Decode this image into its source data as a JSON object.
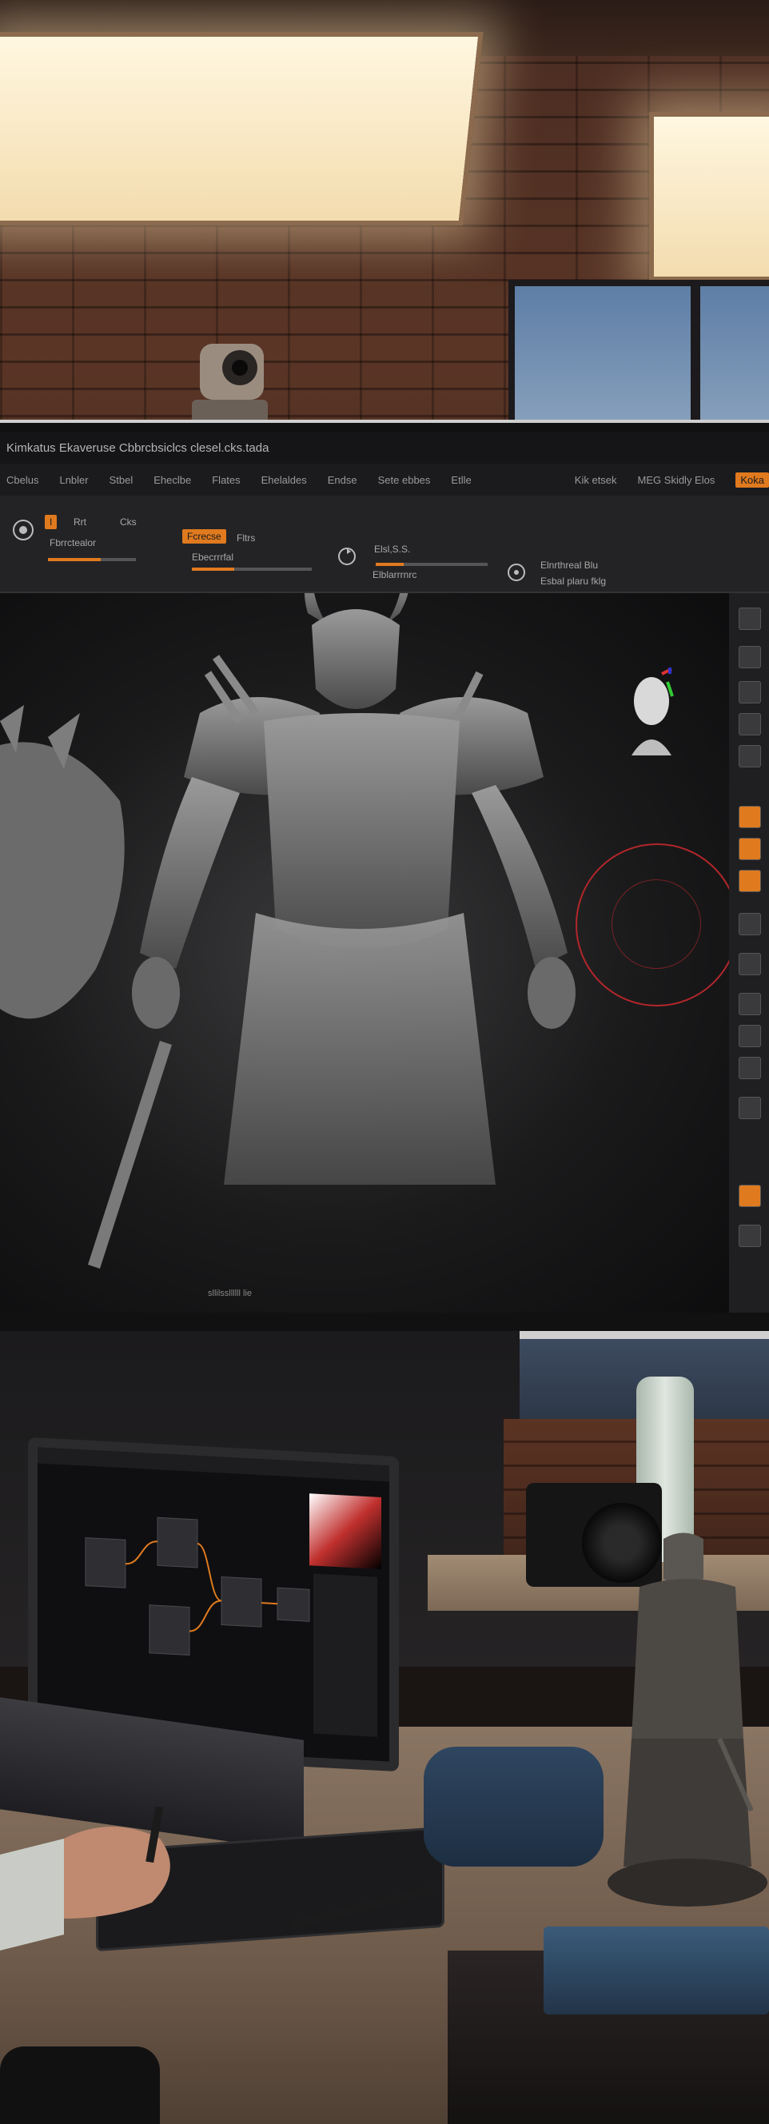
{
  "scene": {
    "description_icon": "sculpting-studio-photo",
    "monitor": {
      "title": "Kimkatus Ekaveruse Cbbrcbsiclcs clesel.cks.tada",
      "menu": [
        "Cbelus",
        "Lnbler",
        "Stbel",
        "Eheclbe",
        "Flates",
        "Ehelaldes",
        "Endse",
        "Sete ebbes",
        "Etlle"
      ],
      "menu_right": [
        "Kik etsek",
        "MEG Skidly Elos",
        "Koka"
      ],
      "toolbar": {
        "item1_label": "Rrt",
        "item1_sub": "Fbrrctealor",
        "item2_label": "Cks",
        "item3_badge": "Fcrecse",
        "item3_sub": "Ebecrrrfal",
        "item4_label": "Fltrs",
        "item5_label": "Elsl,S.S.",
        "item5_sub": "Elblarrrnrc",
        "item6_label": "Elnrthreal Blu",
        "item6_sub": "Esbal plaru  fklg"
      },
      "status_text": "sllilssllllll lie"
    },
    "accent_color": "#e07a1f",
    "brush_color": "#b3262a"
  }
}
